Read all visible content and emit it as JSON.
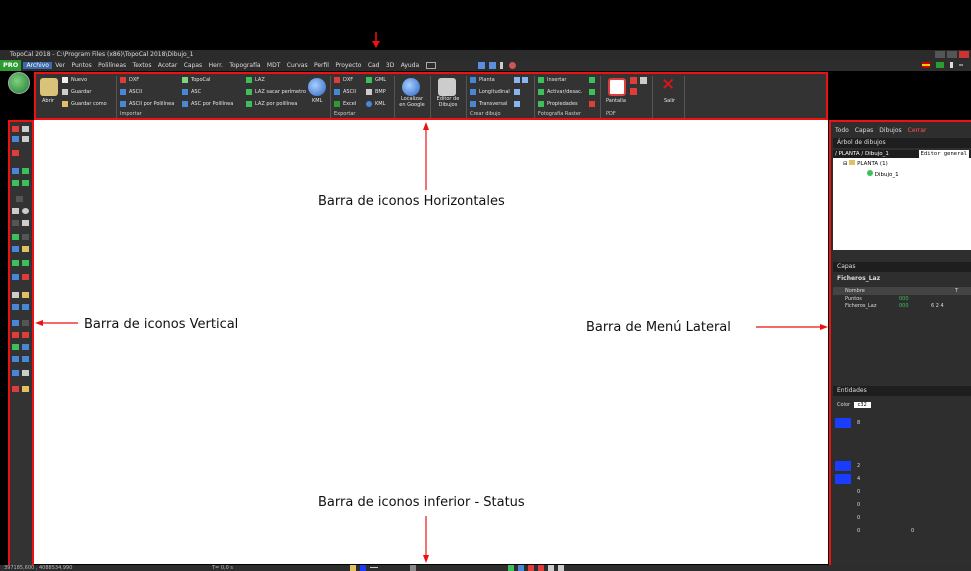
{
  "titlebar": {
    "title": "TopoCal 2018 - C:\\Program Files (x86)\\TopoCal 2018\\Dibujo_1"
  },
  "menubar": {
    "badge": "PRO",
    "items": [
      "Archivo",
      "Ver",
      "Puntos",
      "Polilíneas",
      "Textos",
      "Acotar",
      "Capas",
      "Herr.",
      "Topografía",
      "MDT",
      "Curvas",
      "Perfil",
      "Proyecto",
      "Cad",
      "3D",
      "Ayuda"
    ]
  },
  "ribbon": {
    "archivo": {
      "open": "Abrir",
      "new": "Nuevo",
      "save": "Guardar",
      "save_as": "Guardar como"
    },
    "importar": {
      "label": "Importar",
      "col1": [
        "DXF",
        "ASCII",
        "ASCII por Polilínea"
      ],
      "col2": [
        "TopoCal",
        "ASC",
        "ASC por Polilínea"
      ],
      "col3": [
        "LAZ",
        "LAZ sacar perímetro",
        "LAZ por polilínea"
      ],
      "kml": "KML"
    },
    "exportar": {
      "label": "Exportar",
      "col1": [
        "DXF",
        "ASCII",
        "Excel"
      ],
      "col2": [
        "GML",
        "BMP",
        "KML"
      ]
    },
    "localizar": "Localizar en Google",
    "editor": "Editor de Dibujos",
    "crear": {
      "label": "Crear dibujo",
      "items": [
        "Planta",
        "Longitudinal",
        "Transversal"
      ]
    },
    "raster": {
      "label": "Fotografía Raster",
      "items": [
        "Insertar",
        "Activar/desac.",
        "Propiedades"
      ]
    },
    "pdf": {
      "label": "PDF",
      "pantalla": "Pantalla"
    },
    "salir": "Salir"
  },
  "annotations": {
    "horizontal": "Barra de iconos Horizontales",
    "vertical": "Barra de iconos Vertical",
    "lateral": "Barra de Menú Lateral",
    "status": "Barra de iconos inferior - Status"
  },
  "rpanel": {
    "tabs": [
      "Todo",
      "Capas",
      "Dibujos",
      "Cerrar"
    ],
    "tree_header": "Árbol de dibujos",
    "tree_path": "/ PLANTA / Dibujo_1",
    "editor_label": "Editor general",
    "tree_nodes": [
      "PLANTA (1)",
      "Dibujo_1"
    ],
    "layers_header": "Capas",
    "layers_filter": "Ficheros_Laz",
    "layers_col_name": "Nombre",
    "layers_col_t": "T",
    "layers": [
      {
        "name": "Puntos",
        "val": "000"
      },
      {
        "name": "Ficheros_Laz",
        "val": "000",
        "nums": "6   2   4"
      }
    ],
    "entities_header": "Entidades",
    "entity_color_label": "Color",
    "entity_color_value": "c32",
    "entity_rows": [
      "8",
      "2",
      "4",
      "0",
      "0",
      "0",
      "0"
    ],
    "entity_row_bottom": "0"
  },
  "status": {
    "coords": "397185,600 , 4088534,990",
    "time": "T= 0,0 s"
  },
  "colors": {
    "accent_red": "#ee1111",
    "panel_bg": "#333333",
    "menu_active": "#3c6aa8",
    "pro_green": "#2e9b32"
  }
}
